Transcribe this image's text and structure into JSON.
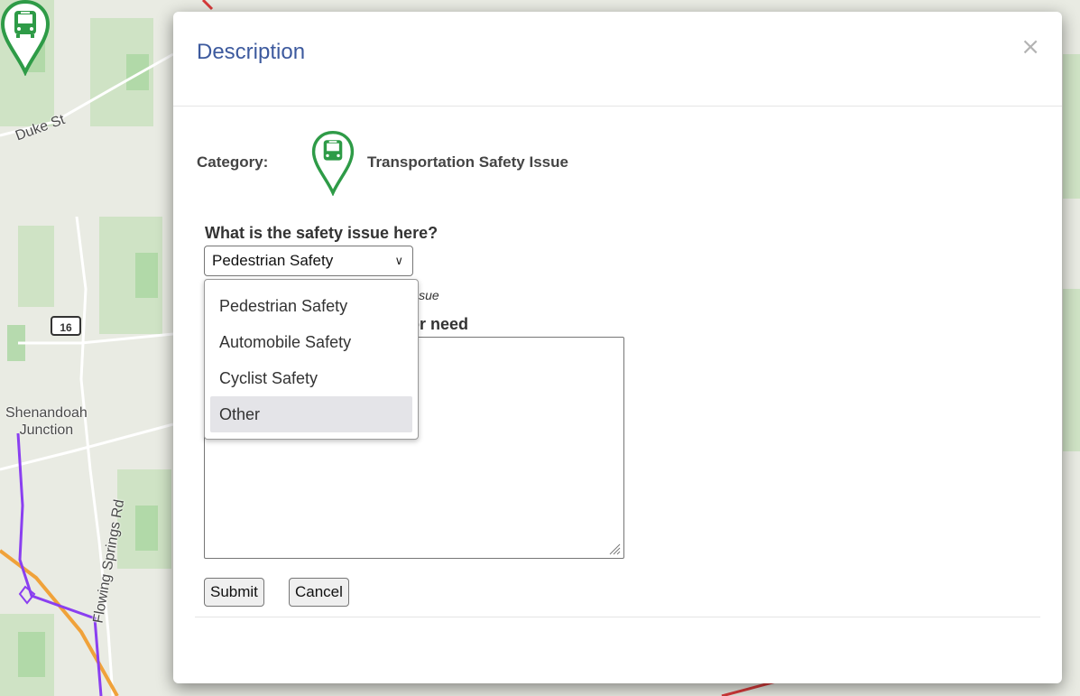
{
  "map": {
    "labels": {
      "duke_st": "Duke St",
      "shenandoah_1": "Shenandoah",
      "shenandoah_2": "Junction",
      "flowing_springs": "Flowing Springs Rd",
      "route": "16"
    },
    "colors": {
      "route_purple": "#8a3ff0",
      "route_orange": "#f0a23a",
      "road_red": "#d83a3a",
      "marker_green": "#2e9b47"
    },
    "marker_icon": "bus-pin-icon"
  },
  "modal": {
    "title": "Description",
    "close_label": "×",
    "category": {
      "label": "Category:",
      "value": "Transportation Safety Issue",
      "icon": "bus-pin-icon"
    },
    "question": "What is the safety issue here?",
    "select": {
      "value": "Pedestrian Safety"
    },
    "hint_partial": "issue",
    "description_label_partial": "or need",
    "buttons": {
      "submit": "Submit",
      "cancel": "Cancel"
    },
    "title_color": "#3d5a9e"
  },
  "dropdown": {
    "options": [
      "Pedestrian Safety",
      "Automobile Safety",
      "Cyclist Safety",
      "Other"
    ],
    "highlighted": "Other"
  }
}
